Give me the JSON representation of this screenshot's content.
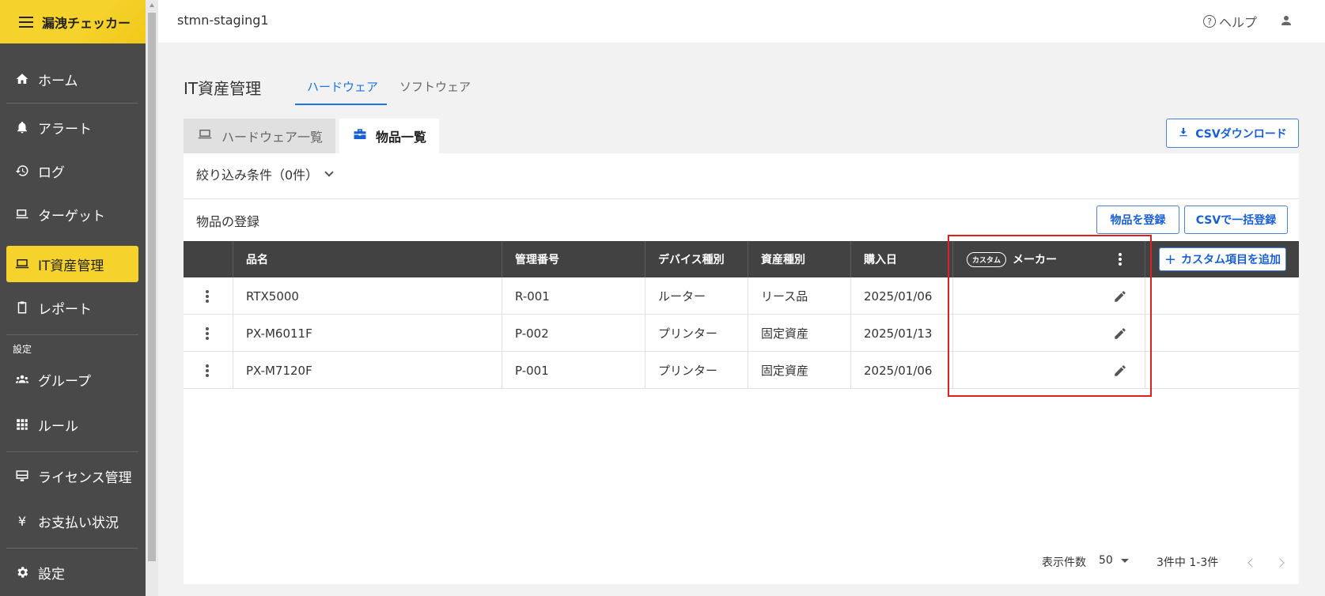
{
  "app": {
    "brand_name": "漏洩チェッカー",
    "project_name": "stmn-staging1",
    "help_label": "ヘルプ"
  },
  "sidebar": {
    "items": [
      {
        "label": "ホーム",
        "icon": "home-icon"
      },
      {
        "label": "アラート",
        "icon": "bell-icon"
      },
      {
        "label": "ログ",
        "icon": "history-icon"
      },
      {
        "label": "ターゲット",
        "icon": "laptop-user-icon"
      },
      {
        "label": "IT資産管理",
        "icon": "laptop-icon",
        "active": true
      },
      {
        "label": "レポート",
        "icon": "clipboard-icon"
      }
    ],
    "settings_section_label": "設定",
    "settings_items": [
      {
        "label": "グループ",
        "icon": "group-icon"
      },
      {
        "label": "ルール",
        "icon": "grid-icon"
      },
      {
        "label": "ライセンス管理",
        "icon": "monitor-icon"
      },
      {
        "label": "お支払い状況",
        "icon": "yen-icon"
      },
      {
        "label": "設定",
        "icon": "gear-icon"
      }
    ]
  },
  "page": {
    "title": "IT資産管理",
    "tabs": [
      {
        "label": "ハードウェア",
        "active": true
      },
      {
        "label": "ソフトウェア",
        "active": false
      }
    ],
    "subtabs": [
      {
        "label": "ハードウェア一覧",
        "active": false
      },
      {
        "label": "物品一覧",
        "active": true
      }
    ],
    "csv_download_label": "CSVダウンロード"
  },
  "card": {
    "filter_label": "絞り込み条件（0件）",
    "register_section_label": "物品の登録",
    "register_button": "物品を登録",
    "csv_bulk_button": "CSVで一括登録",
    "add_custom_button": "カスタム項目を追加"
  },
  "table": {
    "columns": [
      "品名",
      "管理番号",
      "デバイス種別",
      "資産種別",
      "購入日"
    ],
    "custom_badge": "カスタム",
    "custom_column": "メーカー",
    "rows": [
      {
        "name": "RTX5000",
        "code": "R-001",
        "device_type": "ルーター",
        "asset_type": "リース品",
        "purchase_date": "2025/01/06",
        "maker": ""
      },
      {
        "name": "PX-M6011F",
        "code": "P-002",
        "device_type": "プリンター",
        "asset_type": "固定資産",
        "purchase_date": "2025/01/13",
        "maker": ""
      },
      {
        "name": "PX-M7120F",
        "code": "P-001",
        "device_type": "プリンター",
        "asset_type": "固定資産",
        "purchase_date": "2025/01/06",
        "maker": ""
      }
    ]
  },
  "pagination": {
    "page_size_label": "表示件数",
    "page_size": "50",
    "range_text": "3件中 1-3件"
  },
  "colors": {
    "brand_yellow": "#f6d22c",
    "sidebar_bg": "#494949",
    "table_header_bg": "#424242",
    "primary_blue": "#1a5fd0",
    "highlight_red": "#e02020"
  }
}
